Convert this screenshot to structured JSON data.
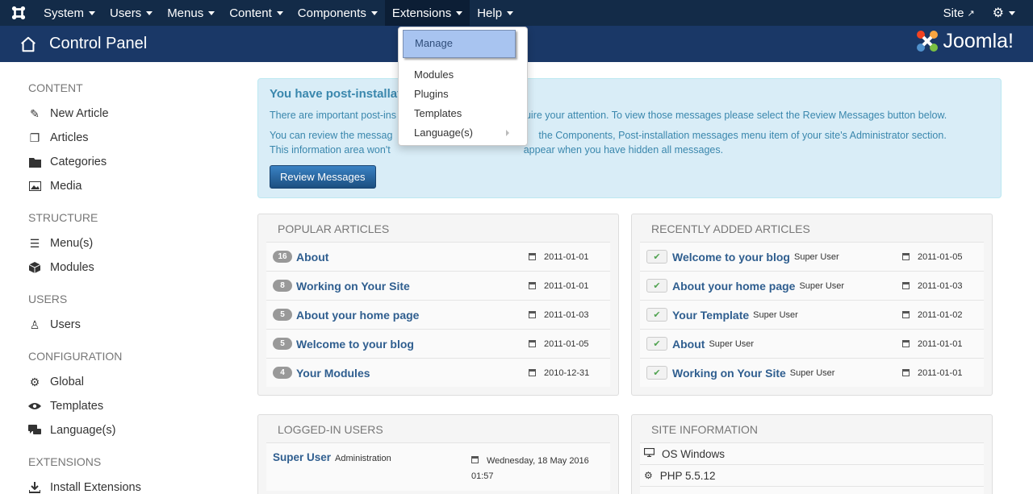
{
  "navbar": {
    "menus": [
      "System",
      "Users",
      "Menus",
      "Content",
      "Components",
      "Extensions",
      "Help"
    ],
    "site_label": "Site"
  },
  "header": {
    "title": "Control Panel",
    "brand": "Joomla!"
  },
  "extensions_menu": {
    "items": [
      "Manage",
      "Modules",
      "Plugins",
      "Templates",
      "Language(s)"
    ]
  },
  "sidebar": {
    "sections": [
      {
        "title": "CONTENT",
        "items": [
          "New Article",
          "Articles",
          "Categories",
          "Media"
        ]
      },
      {
        "title": "STRUCTURE",
        "items": [
          "Menu(s)",
          "Modules"
        ]
      },
      {
        "title": "USERS",
        "items": [
          "Users"
        ]
      },
      {
        "title": "CONFIGURATION",
        "items": [
          "Global",
          "Templates",
          "Language(s)"
        ]
      },
      {
        "title": "EXTENSIONS",
        "items": [
          "Install Extensions"
        ]
      }
    ]
  },
  "alert": {
    "heading": "You have post-installat",
    "line1a": "There are important post-ins",
    "line1b": "quire your attention. To view those messages please select the Review Messages button below.",
    "line2a": "You can review the messag",
    "line2b": "the Components, Post-installation messages menu item of your site's Administrator section.",
    "line3a": "This information area won't",
    "line3b": "appear when you have hidden all messages.",
    "button": "Review Messages"
  },
  "popular": {
    "title": "POPULAR ARTICLES",
    "rows": [
      {
        "hits": "16",
        "title": "About",
        "date": "2011-01-01"
      },
      {
        "hits": "8",
        "title": "Working on Your Site",
        "date": "2011-01-01"
      },
      {
        "hits": "5",
        "title": "About your home page",
        "date": "2011-01-03"
      },
      {
        "hits": "5",
        "title": "Welcome to your blog",
        "date": "2011-01-05"
      },
      {
        "hits": "4",
        "title": "Your Modules",
        "date": "2010-12-31"
      }
    ]
  },
  "recent": {
    "title": "RECENTLY ADDED ARTICLES",
    "rows": [
      {
        "title": "Welcome to your blog",
        "author": "Super User",
        "date": "2011-01-05"
      },
      {
        "title": "About your home page",
        "author": "Super User",
        "date": "2011-01-03"
      },
      {
        "title": "Your Template",
        "author": "Super User",
        "date": "2011-01-02"
      },
      {
        "title": "About",
        "author": "Super User",
        "date": "2011-01-01"
      },
      {
        "title": "Working on Your Site",
        "author": "Super User",
        "date": "2011-01-01"
      }
    ]
  },
  "logged": {
    "title": "LOGGED-IN USERS",
    "user": "Super User",
    "location": "Administration",
    "date": "Wednesday, 18 May 2016",
    "time": "01:57"
  },
  "siteinfo": {
    "title": "SITE INFORMATION",
    "os": "OS Windows",
    "php": "PHP 5.5.12"
  }
}
